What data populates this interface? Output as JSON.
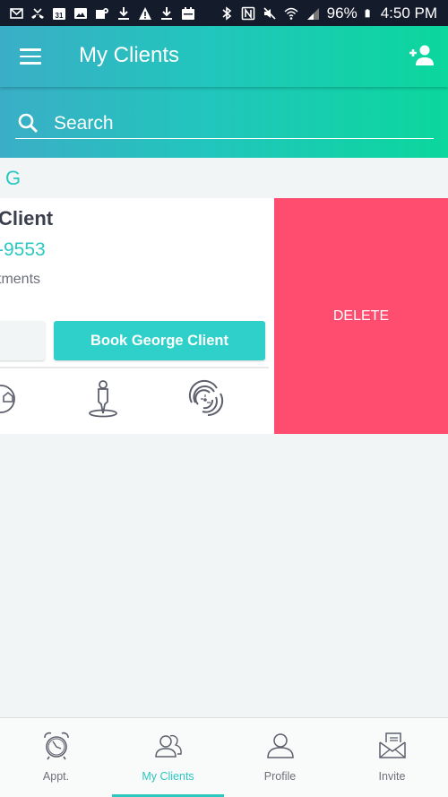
{
  "status_bar": {
    "left_icons": [
      "gmail-icon",
      "missed-call-icon",
      "calendar-31-icon",
      "gallery-icon",
      "maps-icon",
      "download-icon",
      "warning-icon",
      "download-icon",
      "calendar-icon"
    ],
    "right_icons": [
      "bluetooth-icon",
      "nfc-icon",
      "mute-icon",
      "wifi-icon",
      "signal-icon"
    ],
    "battery": "96%",
    "time": "4:50 PM"
  },
  "header": {
    "title": "My Clients",
    "gradient_start": "#3aaec6",
    "gradient_end": "#0bd79d"
  },
  "search": {
    "placeholder": "Search",
    "value": ""
  },
  "list": {
    "section_letter": "G",
    "client": {
      "name": "George Client",
      "name_visible": "Client",
      "phone_visible": "-9553",
      "appointments_visible": "tments",
      "book_button_label": "Book George Client",
      "actions": [
        "home-location-icon",
        "person-location-icon",
        "fingerprint-icon"
      ]
    },
    "swipe_action": {
      "label": "DELETE",
      "color": "#ff4d6f"
    }
  },
  "bottom_nav": {
    "accent": "#2bc7c1",
    "items": [
      {
        "label": "Appt.",
        "icon": "alarm-clock-icon",
        "active": false
      },
      {
        "label": "My Clients",
        "icon": "clients-icon",
        "active": true
      },
      {
        "label": "Profile",
        "icon": "profile-icon",
        "active": false
      },
      {
        "label": "Invite",
        "icon": "invite-envelope-icon",
        "active": false
      }
    ]
  }
}
